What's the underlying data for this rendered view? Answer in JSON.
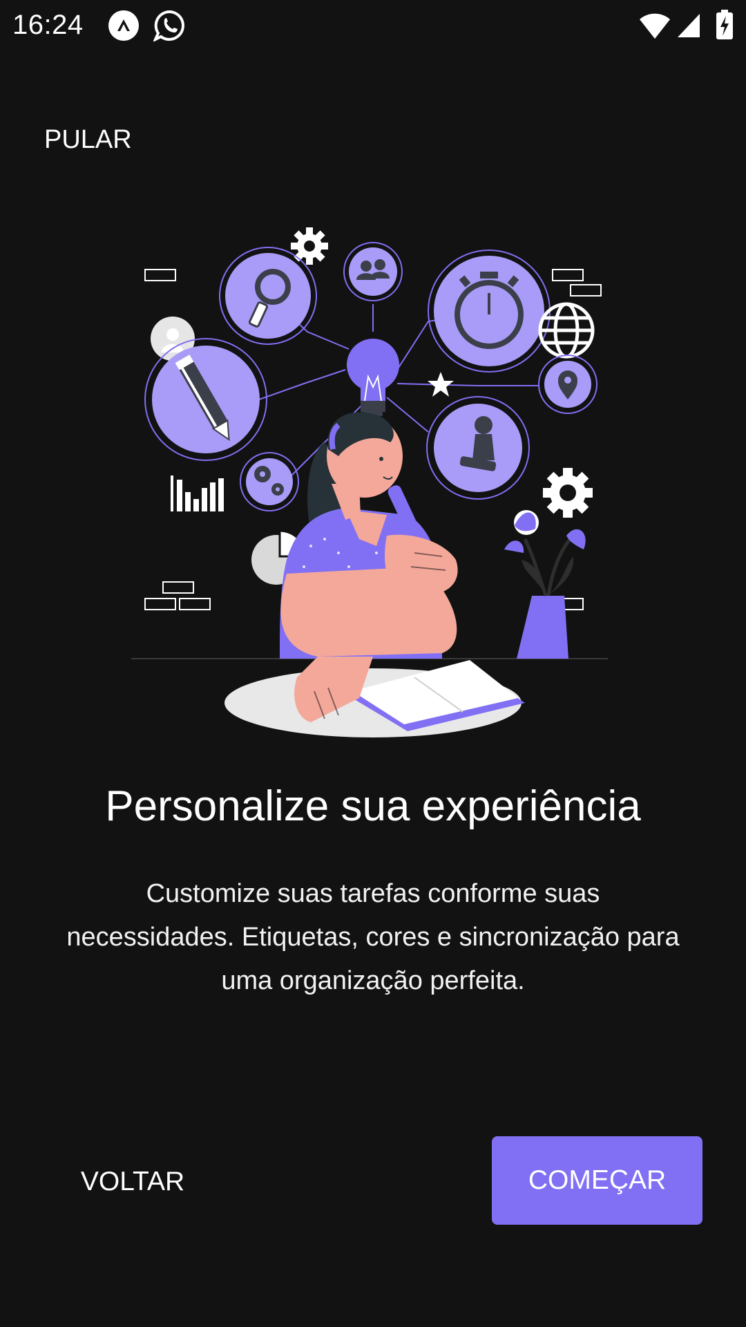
{
  "status_bar": {
    "time": "16:24",
    "notification_icons": [
      "app-notification-icon",
      "whatsapp-icon"
    ],
    "system_icons": [
      "wifi-icon",
      "cellular-signal-icon",
      "battery-charging-icon"
    ]
  },
  "onboarding": {
    "skip_label": "PULAR",
    "title": "Personalize sua experiência",
    "description": "Customize suas tarefas conforme suas necessidades. Etiquetas, cores e sincronização para uma organização perfeita.",
    "back_label": "VOLTAR",
    "start_label": "COMEÇAR"
  },
  "colors": {
    "background": "#121212",
    "accent": "#8170f3",
    "illustration_light": "#a99cf8",
    "skin": "#f4a89a",
    "text": "#ffffff"
  }
}
